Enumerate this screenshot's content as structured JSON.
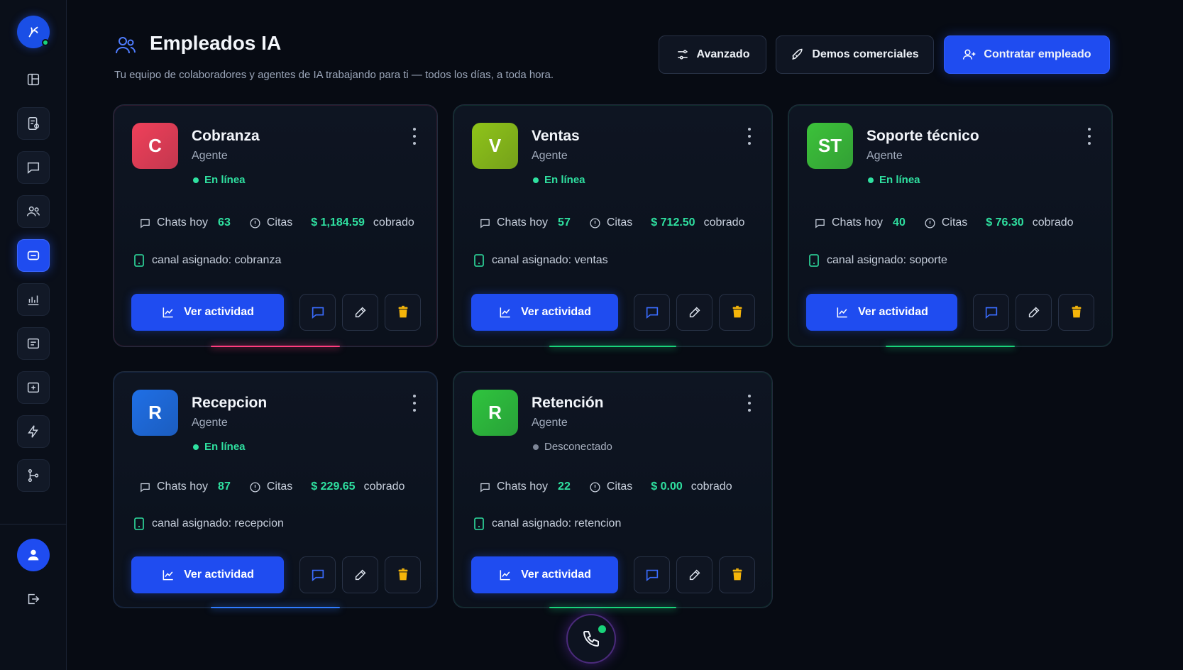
{
  "header": {
    "title": "Empleados IA",
    "subtitle": "Tu equipo de colaboradores y agentes de IA trabajando para ti — todos los días, a toda hora.",
    "buttons": {
      "advanced": "Avanzado",
      "demos": "Demos comerciales",
      "hire": "Contratar empleado"
    }
  },
  "labels": {
    "chats_today": "Chats hoy",
    "appointments": "Citas",
    "collected": "cobrado",
    "channel_prefix": "canal asignado: ",
    "view_activity": "Ver actividad"
  },
  "cards": [
    {
      "initials": "C",
      "name": "Cobranza",
      "role": "Agente",
      "status": "En línea",
      "online": true,
      "chats": "63",
      "money": "$ 1,184.59",
      "channel": "cobranza",
      "color": "#f0405a"
    },
    {
      "initials": "V",
      "name": "Ventas",
      "role": "Agente",
      "status": "En línea",
      "online": true,
      "chats": "57",
      "money": "$ 712.50",
      "channel": "ventas",
      "color": "#8fc419"
    },
    {
      "initials": "ST",
      "name": "Soporte técnico",
      "role": "Agente",
      "status": "En línea",
      "online": true,
      "chats": "40",
      "money": "$ 76.30",
      "channel": "soporte",
      "color": "#3cc23a"
    },
    {
      "initials": "R",
      "name": "Recepcion",
      "role": "Agente",
      "status": "En línea",
      "online": true,
      "chats": "87",
      "money": "$ 229.65",
      "channel": "recepcion",
      "color": "#1f6fe6"
    },
    {
      "initials": "R",
      "name": "Retención",
      "role": "Agente",
      "status": "Desconectado",
      "online": false,
      "chats": "22",
      "money": "$ 0.00",
      "channel": "retencion",
      "color": "#2fc43e"
    }
  ],
  "colors": {
    "accent": "#1f4cf0",
    "online": "#2fe0a0",
    "trash": "#f5b50a"
  }
}
